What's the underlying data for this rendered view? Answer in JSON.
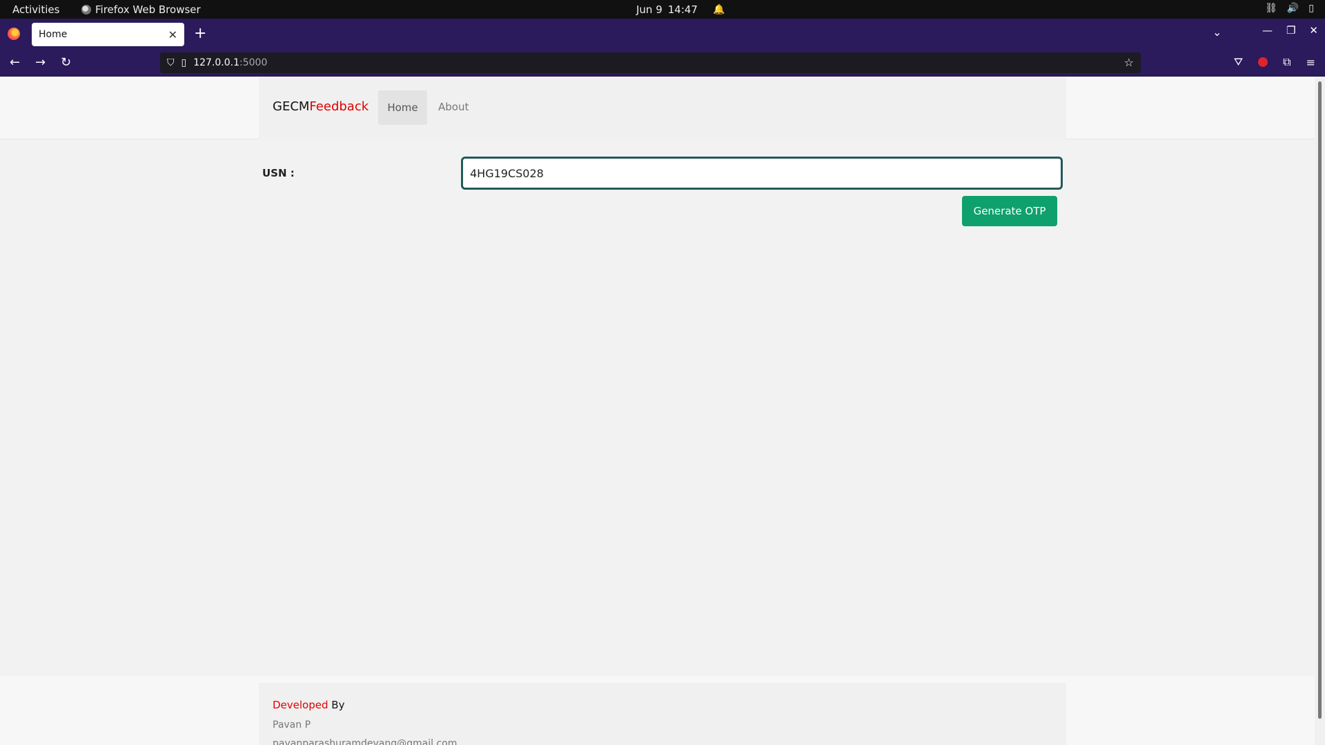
{
  "system_bar": {
    "activities": "Activities",
    "app_name": "Firefox Web Browser",
    "date": "Jun 9",
    "time": "14:47"
  },
  "browser": {
    "tab_title": "Home",
    "url_host": "127.0.0.1",
    "url_port": ":5000"
  },
  "site_nav": {
    "brand_primary": "GECM",
    "brand_accent": "Feedback",
    "links": [
      "Home",
      "About"
    ],
    "active_link": "Home"
  },
  "form": {
    "usn_label": "USN :",
    "usn_value": "4HG19CS028",
    "submit_label": "Generate OTP"
  },
  "footer": {
    "developed_accent": "Developed",
    "developed_rest": " By",
    "developer_name": "Pavan P",
    "developer_email": "pavanparashuramdevang@gmail.com"
  },
  "colors": {
    "browser_chrome": "#2b1a5c",
    "brand_accent": "#e10000",
    "button_green": "#0ea06d",
    "input_border": "#1f5a57"
  }
}
